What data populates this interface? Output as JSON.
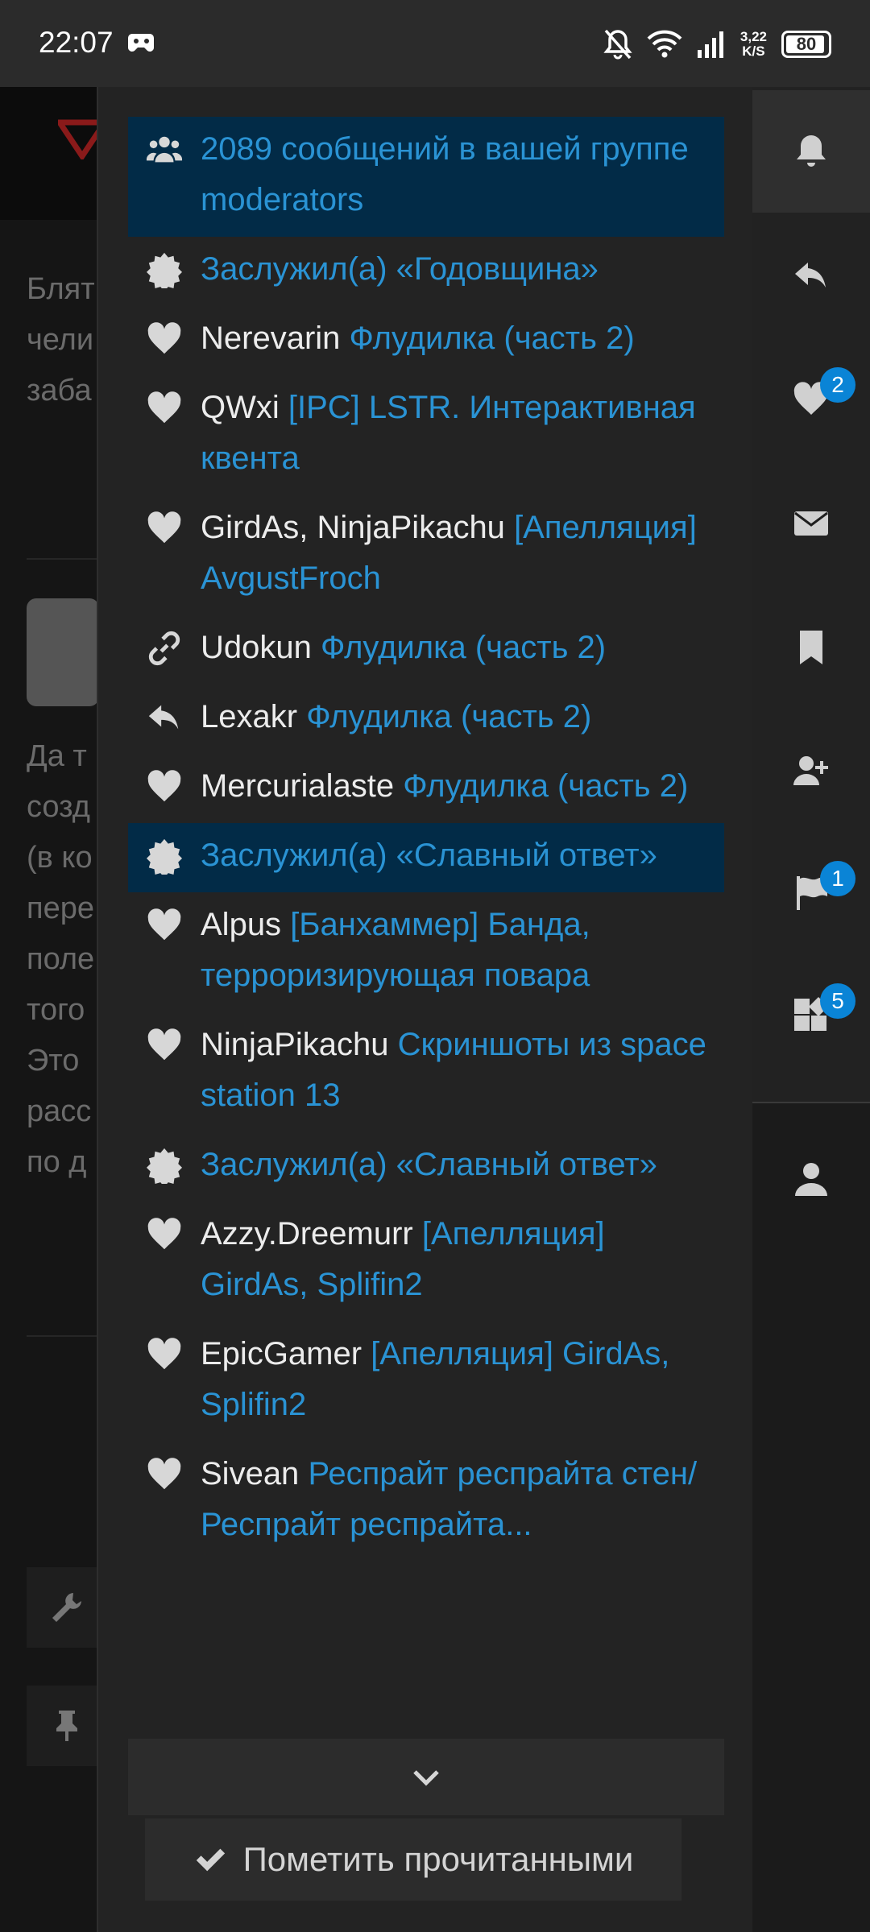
{
  "status_bar": {
    "time": "22:07",
    "net_speed_value": "3,22",
    "net_speed_unit": "K/S",
    "battery_level": "80"
  },
  "background": {
    "text_block_1": [
      "Блят",
      "чели",
      "заба"
    ],
    "text_block_2": [
      "Да т",
      "созд",
      "(в ко",
      "пере",
      "поле",
      "того",
      "Это ",
      "расс",
      "по д"
    ]
  },
  "alerts": [
    {
      "icon": "users-icon",
      "user": "",
      "link": "2089 сообщений в вашей группе moderators",
      "highlight": true
    },
    {
      "icon": "badge-icon",
      "user": "",
      "link": "Заслужил(а) «Годовщина»",
      "highlight": false
    },
    {
      "icon": "heart-icon",
      "user": "Nerevarin",
      "link": "Флудилка (часть 2)",
      "highlight": false
    },
    {
      "icon": "heart-icon",
      "user": "QWxi",
      "link": "[IPC] LSTR. Интерактивная квента",
      "highlight": false
    },
    {
      "icon": "heart-icon",
      "user": "GirdAs, NinjaPikachu",
      "link": "[Апелляция] AvgustFroch",
      "highlight": false
    },
    {
      "icon": "link-icon",
      "user": "Udokun",
      "link": "Флудилка (часть 2)",
      "highlight": false
    },
    {
      "icon": "reply-icon",
      "user": "Lexakr",
      "link": "Флудилка (часть 2)",
      "highlight": false
    },
    {
      "icon": "heart-icon",
      "user": "Mercurialaste",
      "link": "Флудилка (часть 2)",
      "highlight": false
    },
    {
      "icon": "badge-icon",
      "user": "",
      "link": "Заслужил(а) «Славный ответ»",
      "highlight": true
    },
    {
      "icon": "heart-icon",
      "user": "Alpus",
      "link": "[Банхаммер] Банда, терроризирующая повара",
      "highlight": false
    },
    {
      "icon": "heart-icon",
      "user": "NinjaPikachu",
      "link": "Скриншоты из space station 13",
      "highlight": false
    },
    {
      "icon": "badge-icon",
      "user": "",
      "link": "Заслужил(а) «Славный ответ»",
      "highlight": false
    },
    {
      "icon": "heart-icon",
      "user": "Azzy.Dreemurr",
      "link": "[Апелляция] GirdAs, Splifin2",
      "highlight": false
    },
    {
      "icon": "heart-icon",
      "user": "EpicGamer",
      "link": "[Апелляция] GirdAs, Splifin2",
      "highlight": false
    },
    {
      "icon": "heart-icon",
      "user": "Sivean",
      "link": "Респрайт респрайта стен/Респрайт респрайта...",
      "highlight": false
    }
  ],
  "panel": {
    "show_more_icon": "chevron-down-icon",
    "mark_read_label": "Пометить прочитанными"
  },
  "rail": {
    "items": [
      {
        "icon": "bell-icon",
        "badge": ""
      },
      {
        "icon": "reply-icon",
        "badge": ""
      },
      {
        "icon": "heart-icon",
        "badge": "2"
      },
      {
        "icon": "envelope-icon",
        "badge": ""
      },
      {
        "icon": "bookmark-icon",
        "badge": ""
      },
      {
        "icon": "user-plus-icon",
        "badge": ""
      },
      {
        "icon": "flag-icon",
        "badge": "1"
      },
      {
        "icon": "widgets-icon",
        "badge": "5"
      },
      {
        "icon": "user-icon",
        "badge": ""
      }
    ],
    "badge_color": "#0a84d6"
  }
}
